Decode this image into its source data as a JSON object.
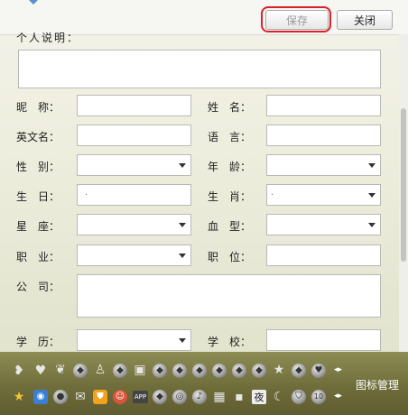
{
  "toolbar": {
    "save_label": "保存",
    "close_label": "关闭"
  },
  "form": {
    "partial_label": "个人说明：",
    "nickname_label": "昵　称：",
    "name_label": "姓　名：",
    "english_name_label": "英文名：",
    "language_label": "语　言：",
    "gender_label": "性　别：",
    "age_label": "年　龄：",
    "birthday_label": "生　日：",
    "zodiac_label": "生　肖：",
    "constellation_label": "星　座：",
    "blood_type_label": "血　型：",
    "occupation_label": "职　业：",
    "position_label": "职　位：",
    "company_label": "公　司：",
    "education_label": "学　历：",
    "school_label": "学　校：",
    "birthday_value": ".",
    "zodiac_value": "."
  },
  "icon_bar": {
    "manage_label": "图标管理",
    "row1_icons": [
      "heart-icon",
      "heart-icon",
      "badge-icon",
      "diamond-icon",
      "penguin-icon",
      "diamond-icon",
      "device-icon",
      "diamond-icon",
      "diamond-icon",
      "diamond-icon",
      "diamond-icon",
      "diamond-icon",
      "diamond-icon",
      "star-icon",
      "diamond-icon",
      "heart-icon"
    ],
    "row2_icons": [
      "star-icon",
      "qzone-icon",
      "eye-icon",
      "mail-icon",
      "shield-icon",
      "face-icon",
      "app-icon",
      "diamond-icon",
      "vip-icon",
      "music-icon",
      "grid-icon",
      "camera-icon",
      "night-icon",
      "moon-icon",
      "shield-icon",
      "number-icon"
    ],
    "app_text": "APP",
    "night_text": "夜",
    "number_text": "10"
  }
}
